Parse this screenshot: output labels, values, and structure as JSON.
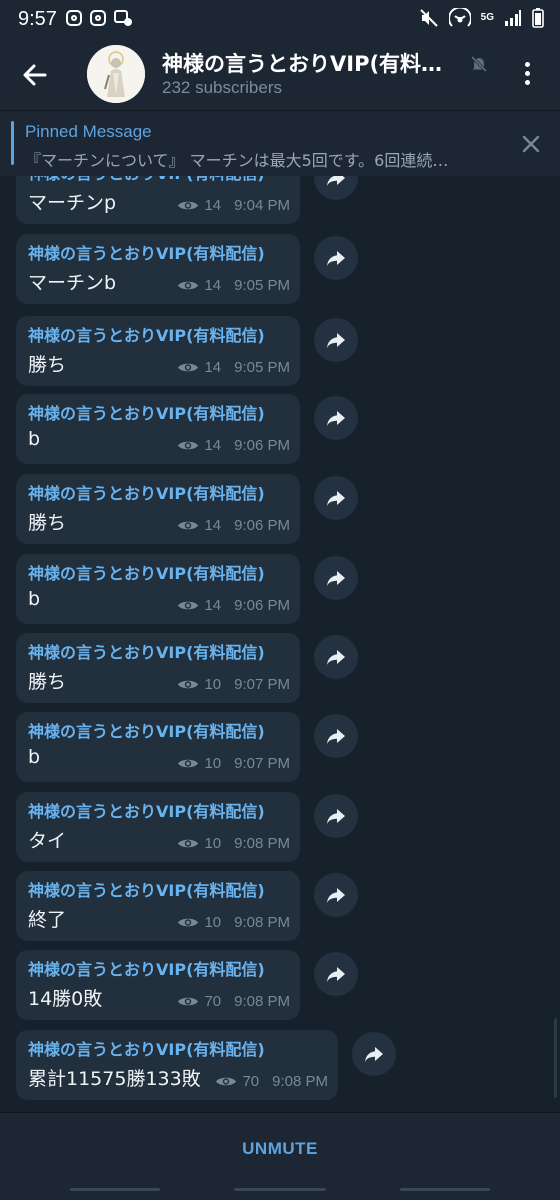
{
  "status_bar": {
    "time": "9:57",
    "network_label": "5G"
  },
  "header": {
    "title": "神様の言うとおりVIP(有料…",
    "subscribers": "232 subscribers"
  },
  "pinned": {
    "label": "Pinned Message",
    "text": "『マーチンについて』 マーチンは最大5回です。6回連続…"
  },
  "messages": [
    {
      "sender": "神様の言うとおりVIP(有料配信)",
      "text": "マーチンp",
      "views": "14",
      "time": "9:04 PM"
    },
    {
      "sender": "神様の言うとおりVIP(有料配信)",
      "text": "マーチンb",
      "views": "14",
      "time": "9:05 PM"
    },
    {
      "sender": "神様の言うとおりVIP(有料配信)",
      "text": "勝ち",
      "views": "14",
      "time": "9:05 PM"
    },
    {
      "sender": "神様の言うとおりVIP(有料配信)",
      "text": "b",
      "views": "14",
      "time": "9:06 PM"
    },
    {
      "sender": "神様の言うとおりVIP(有料配信)",
      "text": "勝ち",
      "views": "14",
      "time": "9:06 PM"
    },
    {
      "sender": "神様の言うとおりVIP(有料配信)",
      "text": "b",
      "views": "14",
      "time": "9:06 PM"
    },
    {
      "sender": "神様の言うとおりVIP(有料配信)",
      "text": "勝ち",
      "views": "10",
      "time": "9:07 PM"
    },
    {
      "sender": "神様の言うとおりVIP(有料配信)",
      "text": "b",
      "views": "10",
      "time": "9:07 PM"
    },
    {
      "sender": "神様の言うとおりVIP(有料配信)",
      "text": "タイ",
      "views": "10",
      "time": "9:08 PM"
    },
    {
      "sender": "神様の言うとおりVIP(有料配信)",
      "text": "終了",
      "views": "10",
      "time": "9:08 PM"
    },
    {
      "sender": "神様の言うとおりVIP(有料配信)",
      "text": "14勝0敗",
      "views": "70",
      "time": "9:08 PM"
    },
    {
      "sender": "神様の言うとおりVIP(有料配信)",
      "text": "累計11575勝133敗",
      "views": "70",
      "time": "9:08 PM"
    }
  ],
  "bottom": {
    "unmute_label": "UNMUTE"
  },
  "colors": {
    "background": "#17212b",
    "header": "#1c2733",
    "bubble": "#222f3c",
    "accent": "#5fa3de",
    "sender": "#69b3ef"
  },
  "icons": {
    "back": "arrow-left-icon",
    "muted": "muted-bell-icon",
    "menu": "more-vertical-icon",
    "close": "close-icon",
    "views": "eye-icon",
    "forward": "share-forward-icon"
  }
}
